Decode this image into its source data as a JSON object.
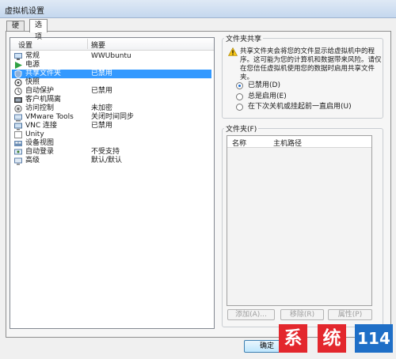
{
  "window": {
    "title": "虚拟机设置"
  },
  "tabs": [
    {
      "label": "硬件"
    },
    {
      "label": "选项"
    }
  ],
  "settings_list": {
    "columns": {
      "settings": "设置",
      "summary": "摘要"
    },
    "rows": [
      {
        "name": "常规",
        "summary": "WWUbuntu",
        "icon": "general-icon"
      },
      {
        "name": "电源",
        "summary": "",
        "icon": "power-icon"
      },
      {
        "name": "共享文件夹",
        "summary": "已禁用",
        "icon": "shared-folders-icon"
      },
      {
        "name": "快照",
        "summary": "",
        "icon": "snapshot-icon"
      },
      {
        "name": "自动保护",
        "summary": "已禁用",
        "icon": "autoprotect-icon"
      },
      {
        "name": "客户机隔离",
        "summary": "",
        "icon": "guest-isolation-icon"
      },
      {
        "name": "访问控制",
        "summary": "未加密",
        "icon": "access-control-icon"
      },
      {
        "name": "VMware Tools",
        "summary": "关闭时间同步",
        "icon": "vmware-tools-icon"
      },
      {
        "name": "VNC 连接",
        "summary": "已禁用",
        "icon": "vnc-icon"
      },
      {
        "name": "Unity",
        "summary": "",
        "icon": "unity-icon"
      },
      {
        "name": "设备视图",
        "summary": "",
        "icon": "device-view-icon"
      },
      {
        "name": "自动登录",
        "summary": "不受支持",
        "icon": "autologin-icon"
      },
      {
        "name": "高级",
        "summary": "默认/默认",
        "icon": "advanced-icon"
      }
    ]
  },
  "folder_sharing": {
    "title": "文件夹共享",
    "warning": "共享文件夹会将您的文件显示给虚拟机中的程序。这可能为您的计算机和数据带来风险。请仅在您信任虚拟机使用您的数据时启用共享文件夹。",
    "options": [
      {
        "label": "已禁用(D)",
        "selected": true
      },
      {
        "label": "总是启用(E)",
        "selected": false
      },
      {
        "label": "在下次关机或挂起前一直启用(U)",
        "selected": false
      }
    ]
  },
  "folders": {
    "title": "文件夹(F)",
    "columns": {
      "name": "名称",
      "host_path": "主机路径"
    },
    "add_label": "添加(A)...",
    "remove_label": "移除(R)",
    "properties_label": "属性(P)"
  },
  "footer": {
    "ok_label": "确定"
  },
  "watermark": [
    "系",
    "统",
    "114"
  ],
  "colors": {
    "selection": "#3399ff",
    "watermark_red": "#e3272d",
    "watermark_blue": "#1f6fc7"
  }
}
